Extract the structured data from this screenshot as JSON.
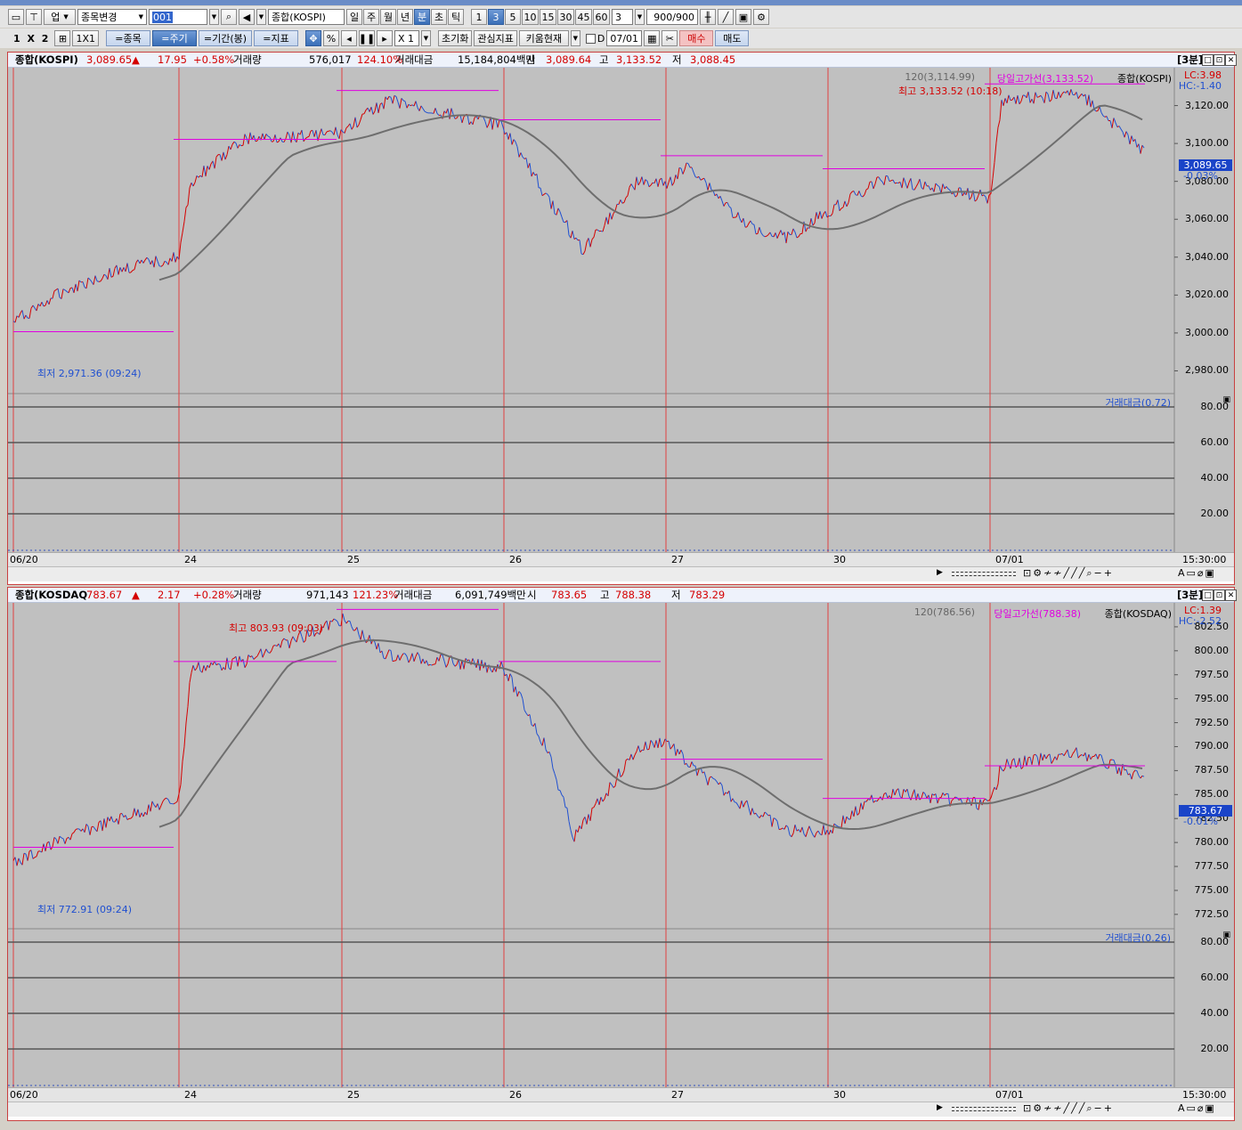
{
  "toolbar1": {
    "market": "업",
    "search_label": "종목변경",
    "code": "001",
    "name": "종합(KOSPI)",
    "periods": [
      "일",
      "주",
      "월",
      "년",
      "분",
      "초",
      "틱"
    ],
    "active_period": "분",
    "intervals": [
      "1",
      "3",
      "5",
      "10",
      "15",
      "30",
      "45",
      "60"
    ],
    "active_interval": "3",
    "interval_value": "3",
    "count": "900",
    "count_total": "/900"
  },
  "toolbar2": {
    "layout": "1 X 2",
    "one": "1X1",
    "stock_btn": "=종목",
    "cycle_btn": "=주기",
    "period_btn": "=기간(봉)",
    "ind_btn": "=지표",
    "pct": "%",
    "zoom": "X 1",
    "reset": "초기화",
    "watch": "관심지표",
    "kiwoom": "키움현재",
    "checkbox_label": "D",
    "date": "07/01",
    "buy": "매수",
    "sell": "매도"
  },
  "panels": [
    {
      "name": "종합(KOSPI)",
      "price": "3,089.65",
      "arrow": "▲",
      "change": "17.95",
      "rate": "+0.58%",
      "vol_label": "거래량",
      "volume": "576,017",
      "vol_ratio": "124.10%",
      "amt_label": "거래대금",
      "amount": "15,184,804백만",
      "open_label": "시",
      "open": "3,089.64",
      "high_label": "고",
      "high": "3,133.52",
      "low_label": "저",
      "low": "3,088.45",
      "period_tag": "[3분]",
      "ma_label": "120(3,114.99)",
      "dayhigh_label": "당일고가선(3,133.52)",
      "series_label": "종합(KOSPI)",
      "lc": "LC:3.98",
      "hc": "HC:-1.40",
      "cur_tag": "3,089.65",
      "cur_pct": "-0.03%",
      "max_ann": "최고 3,133.52 (10:18)",
      "min_ann": "최저 2,971.36 (09:24)",
      "yticks": [
        "3,120.00",
        "3,100.00",
        "3,080.00",
        "3,060.00",
        "3,040.00",
        "3,020.00",
        "3,000.00",
        "2,980.00"
      ],
      "sub_label": "거래대금(0.72)",
      "sub_ticks": [
        "80.00",
        "60.00",
        "40.00",
        "20.00"
      ],
      "xlabels": [
        "06/20",
        "24",
        "25",
        "26",
        "27",
        "30",
        "07/01"
      ],
      "time": "15:30:00"
    },
    {
      "name": "종합(KOSDAQ",
      "price": "783.67",
      "arrow": "▲",
      "change": "2.17",
      "rate": "+0.28%",
      "vol_label": "거래량",
      "volume": "971,143",
      "vol_ratio": "121.23%",
      "amt_label": "거래대금",
      "amount": "6,091,749백만",
      "open_label": "시",
      "open": "783.65",
      "high_label": "고",
      "high": "788.38",
      "low_label": "저",
      "low": "783.29",
      "period_tag": "[3분]",
      "ma_label": "120(786.56)",
      "dayhigh_label": "당일고가선(788.38)",
      "series_label": "종합(KOSDAQ)",
      "lc": "LC:1.39",
      "hc": "HC:-2.52",
      "cur_tag": "783.67",
      "cur_pct": "-0.01%",
      "max_ann": "최고 803.93 (09:03)",
      "min_ann": "최저 772.91 (09:24)",
      "yticks": [
        "802.50",
        "800.00",
        "797.50",
        "795.00",
        "792.50",
        "790.00",
        "787.50",
        "785.00",
        "782.50",
        "780.00",
        "777.50",
        "775.00",
        "772.50"
      ],
      "sub_label": "거래대금(0.26)",
      "sub_ticks": [
        "80.00",
        "60.00",
        "40.00",
        "20.00"
      ],
      "xlabels": [
        "06/20",
        "24",
        "25",
        "26",
        "27",
        "30",
        "07/01"
      ],
      "time": "15:30:00"
    }
  ],
  "colors": {
    "up": "#d40000",
    "down": "#1f4fd0",
    "ma": "#6e6e6e",
    "highline": "#e000e0",
    "session": "#e04040",
    "bg": "#c0c0c0",
    "cur_tag_bg": "#1a44c8"
  }
}
